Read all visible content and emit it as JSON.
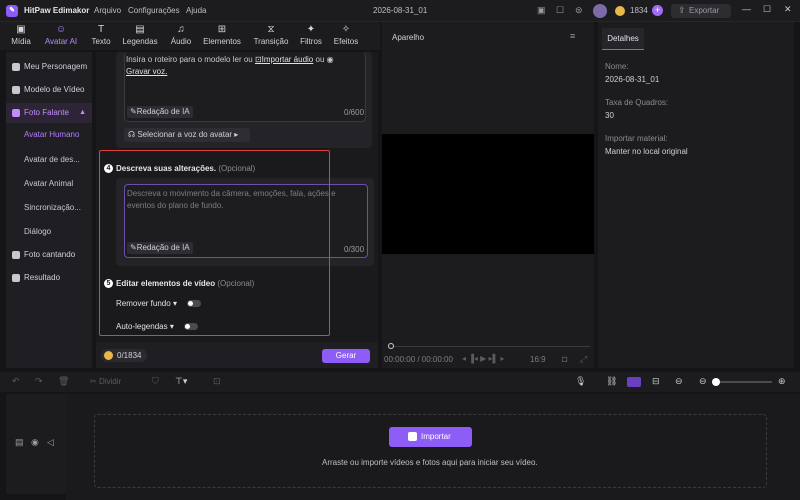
{
  "app": {
    "name": "HitPaw Edimakor",
    "menu": [
      "Arquivo",
      "Configurações",
      "Ajuda"
    ],
    "project": "2026-08-31_01",
    "credits": "1834",
    "export": "Exportar"
  },
  "tools": [
    {
      "label": "Mídia",
      "icon": "media-icon"
    },
    {
      "label": "Avatar AI",
      "icon": "avatar-ai-icon"
    },
    {
      "label": "Texto",
      "icon": "text-icon"
    },
    {
      "label": "Legendas",
      "icon": "subtitles-icon"
    },
    {
      "label": "Áudio",
      "icon": "audio-icon"
    },
    {
      "label": "Elementos",
      "icon": "elements-icon"
    },
    {
      "label": "Transição",
      "icon": "transition-icon"
    },
    {
      "label": "Filtros",
      "icon": "filters-icon"
    },
    {
      "label": "Efeitos",
      "icon": "effects-icon"
    }
  ],
  "sidebar": {
    "items": [
      "Meu Personagem",
      "Modelo de Vídeo",
      "Foto Falante",
      "Foto cantando",
      "Resultado"
    ],
    "sub": [
      "Avatar Humano",
      "Avatar de des...",
      "Avatar Animal",
      "Sincronização...",
      "Diálogo"
    ]
  },
  "script": {
    "hint_line1": "Insira o roteiro para o modelo ler ou",
    "import_audio": "Importar áudio",
    "or": "ou",
    "record": "Gravar voz.",
    "ai_write": "Redação de IA",
    "count": "0/600",
    "voice": "Selecionar a voz do avatar"
  },
  "step4": {
    "num": "4",
    "title": "Descreva suas alterações.",
    "optional": "(Opcional)",
    "placeholder": "Descreva o movimento da câmera, emoções, fala, ações e eventos do plano de fundo.",
    "ai_write": "Redação de IA",
    "count": "0/300"
  },
  "step5": {
    "num": "5",
    "title": "Editar elementos de vídeo",
    "optional": "(Opcional)",
    "remove_bg": "Remover fundo",
    "auto_captions": "Auto-legendas"
  },
  "footer": {
    "credits": "0/1834",
    "generate": "Gerar"
  },
  "preview": {
    "title": "Aparelho",
    "time": "00:00:00 / 00:00:00",
    "ratio": "16:9"
  },
  "details": {
    "tab": "Detalhes",
    "name_label": "Nome:",
    "name_value": "2026-08-31_01",
    "fps_label": "Taxa de Quadros:",
    "fps_value": "30",
    "import_label": "Importar material:",
    "import_value": "Manter no local original"
  },
  "timeline": {
    "split": "Dividir",
    "import": "Importar",
    "hint": "Arraste ou importe vídeos e fotos aqui para iniciar seu vídeo."
  }
}
